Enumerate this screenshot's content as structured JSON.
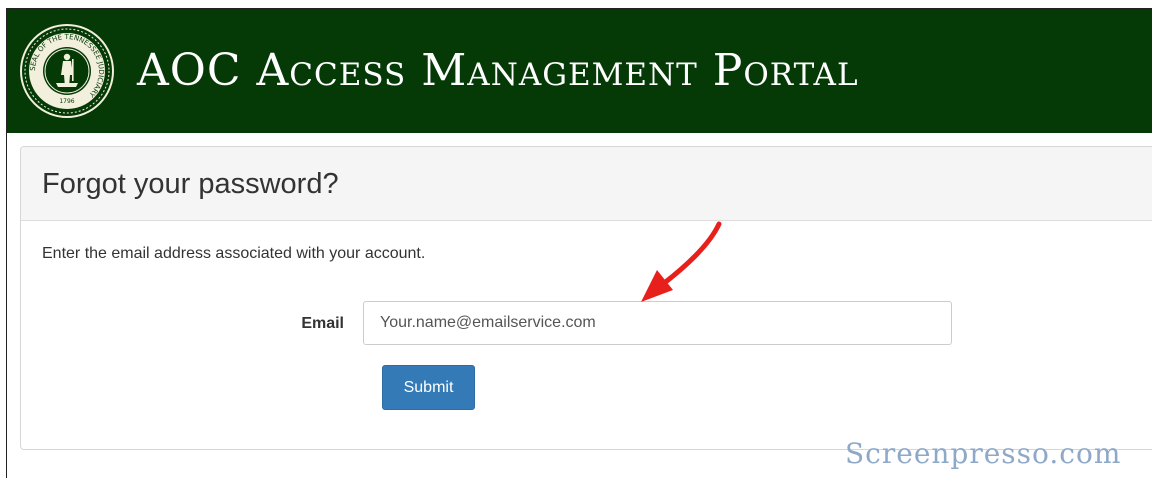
{
  "header": {
    "title": "AOC Access Management Portal",
    "seal": {
      "icon": "tennessee-judiciary-seal-icon",
      "text": "SEAL OF THE TENNESSEE JUDICIARY",
      "year": "1796"
    },
    "background_color": "#053a07"
  },
  "form": {
    "title": "Forgot your password?",
    "instructions": "Enter the email address associated with your account.",
    "email_label": "Email",
    "email_value": "Your.name@emailservice.com",
    "submit_label": "Submit",
    "submit_color": "#337ab7"
  },
  "annotation": {
    "icon": "red-arrow-icon",
    "color": "#e8201c"
  },
  "watermark": {
    "text": "Screenpresso.com"
  }
}
